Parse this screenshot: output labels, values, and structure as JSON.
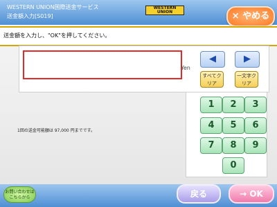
{
  "header": {
    "title_line1": "WESTERN UNION国際送金サービス",
    "title_line2": "送金額入力[S019]",
    "logo_text": "WESTERN UNION",
    "cancel_label": "× やめる"
  },
  "instruction": "送金額を入力し、\"OK\"を押してください。",
  "amount": {
    "value": "",
    "unit": "Yen"
  },
  "controls": {
    "left_arrow": "◀",
    "right_arrow": "▶",
    "clear_all": "すべてクリア",
    "clear_one": "一文字クリア"
  },
  "keypad": [
    "1",
    "2",
    "3",
    "4",
    "5",
    "6",
    "7",
    "8",
    "9",
    "0"
  ],
  "limit_text": "1回の送金可能額は 97,000 円までです。",
  "footer": {
    "inquiry_label": "お問い合わせはこちらから",
    "back_label": "戻る",
    "ok_label": "→ OK"
  },
  "colors": {
    "header_blue": "#4f8fd4",
    "cancel_orange": "#ff7a25",
    "input_border": "#e32a2a",
    "key_green": "#a8e4b8"
  }
}
